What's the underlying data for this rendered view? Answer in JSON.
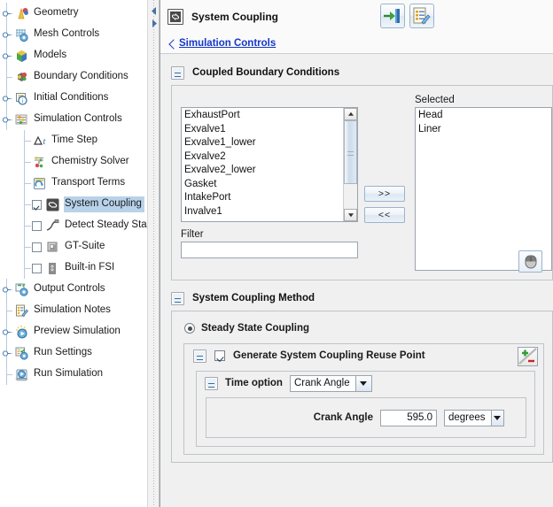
{
  "tree": {
    "items": [
      {
        "label": "Geometry",
        "icon": "geometry-icon",
        "depth": 0,
        "expander": true,
        "checkbox": null,
        "selected": false
      },
      {
        "label": "Mesh Controls",
        "icon": "mesh-controls-icon",
        "depth": 0,
        "expander": true,
        "checkbox": null,
        "selected": false
      },
      {
        "label": "Models",
        "icon": "models-icon",
        "depth": 0,
        "expander": true,
        "checkbox": null,
        "selected": false
      },
      {
        "label": "Boundary Conditions",
        "icon": "boundary-conditions-icon",
        "depth": 0,
        "expander": false,
        "checkbox": null,
        "selected": false
      },
      {
        "label": "Initial Conditions",
        "icon": "initial-conditions-icon",
        "depth": 0,
        "expander": true,
        "checkbox": null,
        "selected": false
      },
      {
        "label": "Simulation Controls",
        "icon": "simulation-controls-icon",
        "depth": 0,
        "expander": true,
        "checkbox": null,
        "selected": false
      },
      {
        "label": "Time Step",
        "icon": "time-step-icon",
        "depth": 1,
        "expander": false,
        "checkbox": null,
        "selected": false
      },
      {
        "label": "Chemistry Solver",
        "icon": "chemistry-solver-icon",
        "depth": 1,
        "expander": false,
        "checkbox": null,
        "selected": false
      },
      {
        "label": "Transport Terms",
        "icon": "transport-terms-icon",
        "depth": 1,
        "expander": false,
        "checkbox": null,
        "selected": false
      },
      {
        "label": "System Coupling",
        "icon": "system-coupling-icon",
        "depth": 1,
        "expander": false,
        "checkbox": true,
        "selected": true
      },
      {
        "label": "Detect Steady State",
        "icon": "detect-steady-state-icon",
        "depth": 1,
        "expander": false,
        "checkbox": false,
        "selected": false
      },
      {
        "label": "GT-Suite",
        "icon": "gt-suite-icon",
        "depth": 1,
        "expander": false,
        "checkbox": false,
        "selected": false
      },
      {
        "label": "Built-in FSI",
        "icon": "built-in-fsi-icon",
        "depth": 1,
        "expander": false,
        "checkbox": false,
        "selected": false
      },
      {
        "label": "Output Controls",
        "icon": "output-controls-icon",
        "depth": 0,
        "expander": true,
        "checkbox": null,
        "selected": false
      },
      {
        "label": "Simulation Notes",
        "icon": "simulation-notes-icon",
        "depth": 0,
        "expander": false,
        "checkbox": null,
        "selected": false
      },
      {
        "label": "Preview Simulation",
        "icon": "preview-simulation-icon",
        "depth": 0,
        "expander": true,
        "checkbox": null,
        "selected": false
      },
      {
        "label": "Run Settings",
        "icon": "run-settings-icon",
        "depth": 0,
        "expander": true,
        "checkbox": null,
        "selected": false
      },
      {
        "label": "Run Simulation",
        "icon": "run-simulation-icon",
        "depth": 0,
        "expander": false,
        "checkbox": null,
        "selected": false
      }
    ]
  },
  "header": {
    "title": "System Coupling",
    "icon": "system-coupling-icon",
    "buttons": [
      {
        "name": "export-button",
        "icon": "door-exit-icon"
      },
      {
        "name": "edit-notes-button",
        "icon": "notes-edit-icon"
      }
    ],
    "back_link": "Simulation Controls"
  },
  "coupled_boundary_conditions": {
    "title": "Coupled Boundary Conditions",
    "available_items": [
      "ExhaustPort",
      "Exvalve1",
      "Exvalve1_lower",
      "Exvalve2",
      "Exvalve2_lower",
      "Gasket",
      "IntakePort",
      "Invalve1"
    ],
    "filter_label": "Filter",
    "filter_value": "",
    "filter_placeholder": "",
    "add_button": ">>",
    "remove_button": "<<",
    "selected_label": "Selected",
    "selected_items": [
      "Head",
      "Liner"
    ],
    "pick_button_icon": "mouse-pick-icon"
  },
  "system_coupling_method": {
    "title": "System Coupling Method",
    "steady_state_label": "Steady State Coupling",
    "steady_state_checked": true,
    "reuse_point_label": "Generate System Coupling Reuse Point",
    "reuse_point_checked": true,
    "plus_minus_icon": "plus-minus-icon",
    "time_option_label": "Time option",
    "time_option_value": "Crank Angle",
    "crank_angle_label": "Crank Angle",
    "crank_angle_value": "595.0",
    "crank_angle_unit": "degrees"
  },
  "colors": {
    "selection": "#b8d2ea",
    "link": "#1437c8",
    "panel_bg": "#f0f0f0",
    "accent_green": "#3ea33e",
    "accent_red": "#cc2222"
  }
}
